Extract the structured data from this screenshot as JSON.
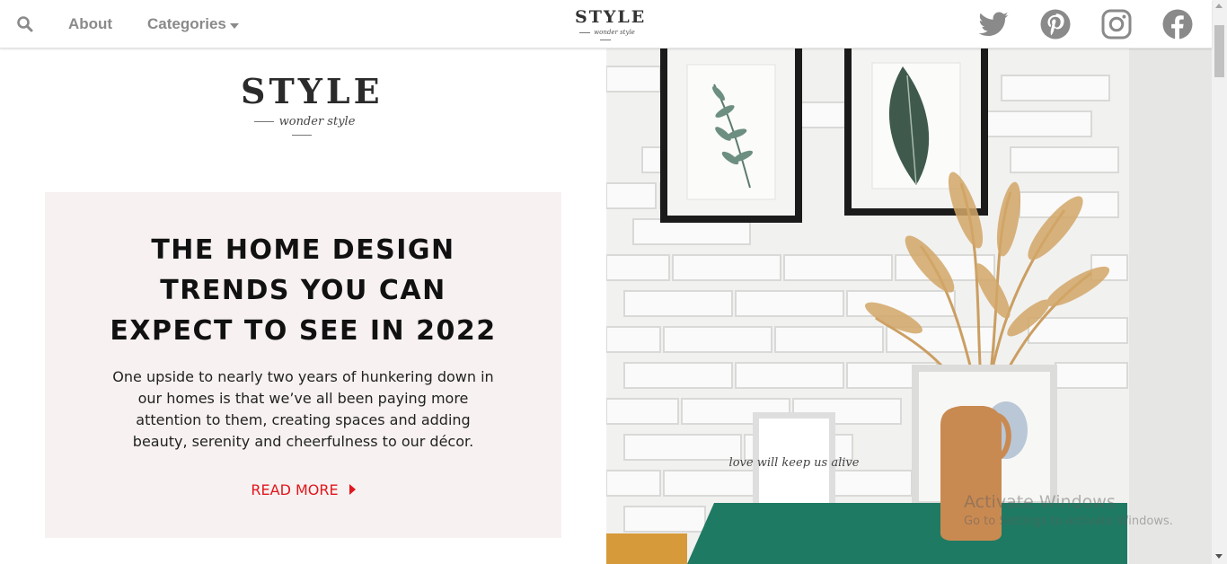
{
  "nav": {
    "about_label": "About",
    "categories_label": "Categories"
  },
  "brand": {
    "name": "STYLE",
    "tagline": "wonder style"
  },
  "social": [
    "twitter-icon",
    "pinterest-icon",
    "instagram-icon",
    "facebook-icon"
  ],
  "hero": {
    "headline": "THE HOME DESIGN TRENDS YOU CAN EXPECT TO SEE IN 2022",
    "body": "One upside to nearly two years of hunkering down in our homes is that we’ve all been paying more attention to them, creating spaces and adding beauty, serenity and cheerfulness to our décor.",
    "read_more_label": "READ MORE",
    "photo_print_text": "love will keep us alive"
  },
  "watermark": {
    "line1": "Activate Windows",
    "line2": "Go to Settings to activate Windows."
  },
  "colors": {
    "accent": "#e0171c",
    "card_bg": "#f7f1f1",
    "nav_text": "#8a8a8a",
    "table_green": "#1f7a63",
    "vase": "#c98a52"
  }
}
